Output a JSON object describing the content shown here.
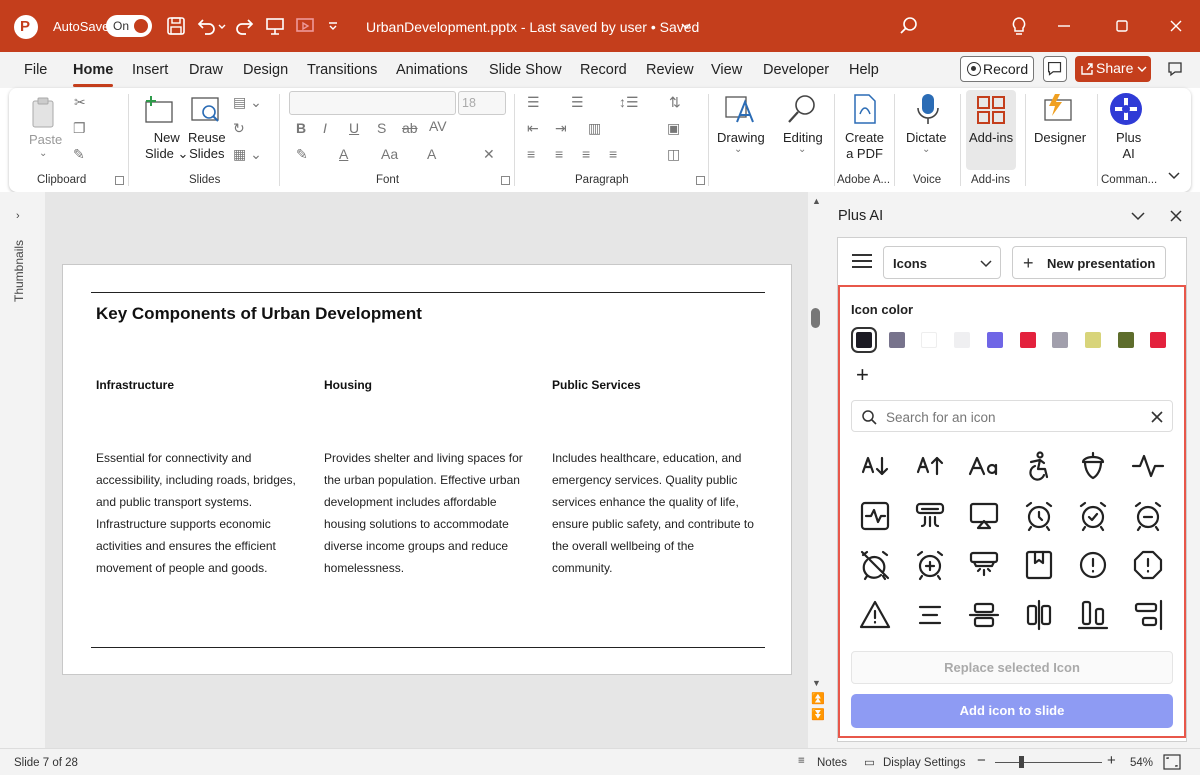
{
  "titlebar": {
    "autosave_label": "AutoSave",
    "autosave_state": "On",
    "doc_title": "UrbanDevelopment.pptx  -  Last saved by user  •  Saved",
    "accent": "#c43e1c"
  },
  "menu": {
    "tabs": [
      "File",
      "Home",
      "Insert",
      "Draw",
      "Design",
      "Transitions",
      "Animations",
      "Slide Show",
      "Record",
      "Review",
      "View",
      "Developer",
      "Help"
    ],
    "active_tab": "Home",
    "record_label": "Record",
    "share_label": "Share"
  },
  "ribbon": {
    "paste": "Paste",
    "new_slide": [
      "New",
      "Slide"
    ],
    "reuse_slides": [
      "Reuse",
      "Slides"
    ],
    "font_size": "18",
    "drawing": "Drawing",
    "editing": "Editing",
    "create_pdf": [
      "Create",
      "a PDF"
    ],
    "dictate": "Dictate",
    "addins": "Add-ins",
    "designer": "Designer",
    "plus_ai": [
      "Plus",
      "AI"
    ],
    "groups": {
      "clipboard": "Clipboard",
      "slides": "Slides",
      "font": "Font",
      "paragraph": "Paragraph",
      "adobe": "Adobe A...",
      "voice": "Voice",
      "addins": "Add-ins",
      "commands": "Comman..."
    }
  },
  "thumbnails_label": "Thumbnails",
  "slide": {
    "title": "Key Components of Urban Development",
    "columns": [
      {
        "heading": "Infrastructure",
        "lines": [
          "Essential for connectivity and",
          "accessibility, including roads, bridges,",
          "and public transport systems.",
          "Infrastructure supports economic",
          "activities and ensures the efficient",
          "movement of people and goods."
        ]
      },
      {
        "heading": "Housing",
        "lines": [
          "Provides shelter and living spaces for",
          "the urban population. Effective urban",
          "development includes affordable",
          "housing solutions to accommodate",
          "diverse income groups and reduce",
          "homelessness."
        ]
      },
      {
        "heading": "Public Services",
        "lines": [
          "Includes healthcare, education, and",
          "emergency services. Quality public",
          "services enhance the quality of life,",
          "ensure public safety, and contribute to",
          "the overall wellbeing of the",
          "community."
        ]
      }
    ]
  },
  "panel": {
    "title": "Plus AI",
    "mode_select": "Icons",
    "new_presentation": "New presentation",
    "icon_color_label": "Icon color",
    "colors": [
      "#1c1b24",
      "#77738c",
      "#ffffff",
      "#efeff1",
      "#6f66e6",
      "#e3223d",
      "#a19fac",
      "#d8d47a",
      "#5e6d2c",
      "#e3223d"
    ],
    "selected_color_index": 0,
    "search_placeholder": "Search for an icon",
    "icons": [
      "arrow-sort-down-icon",
      "arrow-sort-up-icon",
      "text-size-icon",
      "accessibility-icon",
      "acorn-icon",
      "activity-icon",
      "activity-square-icon",
      "air-vent-icon",
      "airplay-icon",
      "alarm-clock-icon",
      "alarm-clock-check-icon",
      "alarm-clock-minus-icon",
      "alarm-clock-off-icon",
      "alarm-clock-plus-icon",
      "alarm-smoke-icon",
      "album-icon",
      "alert-circle-icon",
      "alert-octagon-icon",
      "alert-triangle-icon",
      "align-center-icon",
      "align-center-horizontal-icon",
      "align-center-vertical-icon",
      "align-end-horizontal-icon",
      "align-end-vertical-icon"
    ],
    "replace_label": "Replace selected Icon",
    "add_label": "Add icon to slide",
    "add_color": "#8e9bf3",
    "frame_color": "#e8574a"
  },
  "status": {
    "slide_info": "Slide 7 of 28",
    "notes": "Notes",
    "display_settings": "Display Settings",
    "zoom_pct": "54%",
    "zoom_level": 0.54
  }
}
